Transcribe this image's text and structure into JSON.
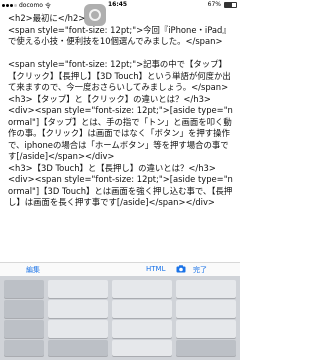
{
  "status_bar": {
    "carrier": "docomo",
    "network": "令",
    "time": "16:45",
    "battery_percent": "67%",
    "battery_level": 0.67
  },
  "editor": {
    "text": "<h2>最初に</h2>\n<span style=\"font-size: 12pt;\">今回『iPhone・iPad』で使える小技・便利技を10個選んでみました。</span>\n\n<span style=\"font-size: 12pt;\">記事の中で【タップ】【クリック】【長押し】【3D Touch】という単語が何度か出て来ますので、今一度おさらいしてみましょう。</span>\n<h3>【タップ】と【クリック】の違いとは？</h3>\n<div><span style=\"font-size: 12pt;\">[aside type=\"normal\"]【タップ】とは、手の指で「トン」と画面を叩く動作の事。【クリック】は画面ではなく「ボタン」を押す操作で、iphoneの場合は「ホームボタン」等を押す場合の事です[/aside]</span></div>\n<h3>【3D Touch】と【長押し】の違いとは？</h3>\n<div><span style=\"font-size: 12pt;\">[aside type=\"normal\"]【3D Touch】とは画面を強く押し込む事で、【長押し】は画面を長く押す事です[/aside]</span></div>"
  },
  "keyboard_toolbar": {
    "edit_label": "編集",
    "html_label": "HTML",
    "camera_icon": "camera-icon",
    "done_label": "完了",
    "accent_color": "#1a73e8"
  }
}
